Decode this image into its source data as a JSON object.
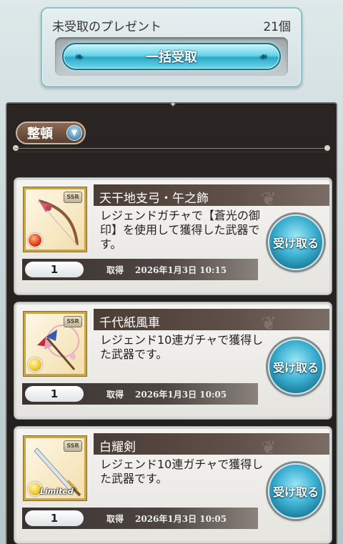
{
  "present_box": {
    "title": "未受取のプレゼント",
    "count": "21個",
    "bulk_button_label": "一括受取"
  },
  "toolbar": {
    "sort_label": "整頓",
    "sort_icon": "chevron-down-icon"
  },
  "gifts": [
    {
      "name": "天干地支弓・午之飾",
      "description": "レジェンドガチャで【蒼光の御印】を使用して獲得した武器です。",
      "quantity": "1",
      "acquired_label": "取得",
      "acquired_date": "2026年1月3日 10:15",
      "rarity": "SSR",
      "element": "fire",
      "weapon_icon": "bow-icon",
      "receive_label": "受け取る"
    },
    {
      "name": "千代紙風車",
      "description": "レジェンド10連ガチャで獲得した武器です。",
      "quantity": "1",
      "acquired_label": "取得",
      "acquired_date": "2026年1月3日 10:05",
      "rarity": "SSR",
      "element": "light",
      "weapon_icon": "pinwheel-icon",
      "receive_label": "受け取る"
    },
    {
      "name": "白耀剣",
      "description": "レジェンド10連ガチャで獲得した武器です。",
      "quantity": "1",
      "acquired_label": "取得",
      "acquired_date": "2026年1月3日 10:05",
      "rarity": "SSR",
      "element": "light",
      "limited_label": "Limited",
      "weapon_icon": "sword-icon",
      "receive_label": "受け取る"
    }
  ],
  "colors": {
    "accent": "#3fb2d3",
    "panel_bg": "#2a2523",
    "card_bg": "#f5f4f1"
  }
}
